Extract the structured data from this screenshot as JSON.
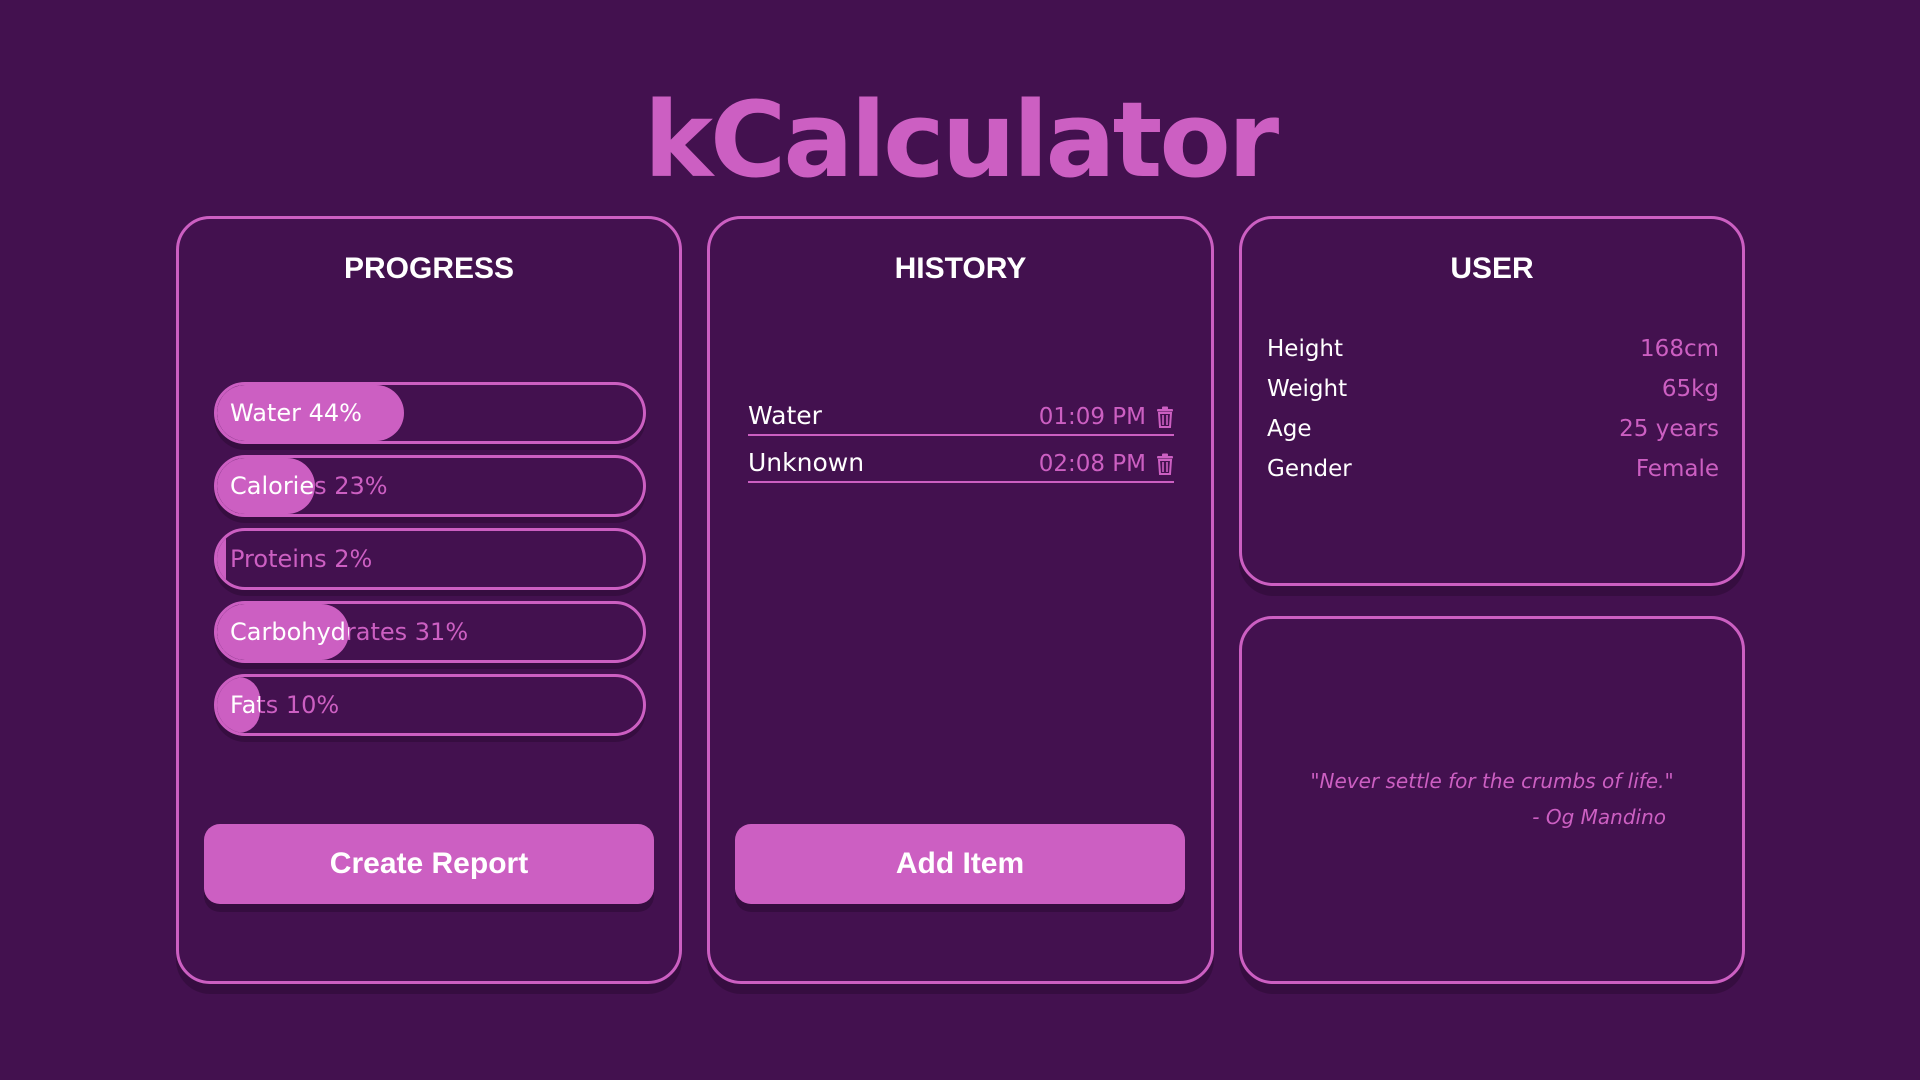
{
  "app": {
    "title": "kCalculator"
  },
  "colors": {
    "background": "#43114f",
    "accent": "#cc5fc2",
    "text": "#ffffff"
  },
  "progress": {
    "title": "PROGRESS",
    "bars": [
      {
        "label": "Water 44%",
        "percent": 44
      },
      {
        "label": "Calories 23%",
        "percent": 23
      },
      {
        "label": "Proteins 2%",
        "percent": 2
      },
      {
        "label": "Carbohydrates 31%",
        "percent": 31
      },
      {
        "label": "Fats 10%",
        "percent": 10
      }
    ],
    "button_label": "Create Report"
  },
  "history": {
    "title": "HISTORY",
    "items": [
      {
        "name": "Water",
        "time": "01:09 PM",
        "icon": "trash-icon"
      },
      {
        "name": "Unknown",
        "time": "02:08 PM",
        "icon": "trash-icon"
      }
    ],
    "button_label": "Add Item"
  },
  "user": {
    "title": "USER",
    "fields": [
      {
        "label": "Height",
        "value": "168cm"
      },
      {
        "label": "Weight",
        "value": "65kg"
      },
      {
        "label": "Age",
        "value": "25 years"
      },
      {
        "label": "Gender",
        "value": "Female"
      }
    ]
  },
  "quote": {
    "text": "\"Never settle for the crumbs of life.\"",
    "author": "- Og Mandino"
  }
}
